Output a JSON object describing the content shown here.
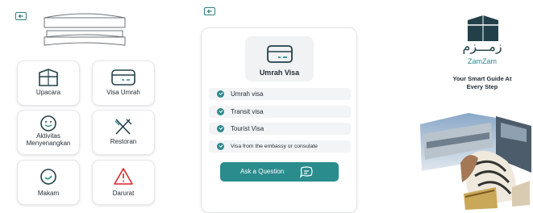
{
  "panel1": {
    "tiles": [
      {
        "label": "Upacara",
        "icon": "kaaba-icon"
      },
      {
        "label": "Visa Umrah",
        "icon": "card-icon"
      },
      {
        "label": "Aktivitas Menyenangkan",
        "icon": "smile-icon"
      },
      {
        "label": "Restoran",
        "icon": "utensils-icon"
      },
      {
        "label": "Makam",
        "icon": "grave-icon"
      },
      {
        "label": "Darurat",
        "icon": "warning-icon"
      }
    ]
  },
  "panel2": {
    "title": "Umrah Visa",
    "items": [
      "Umrah visa",
      "Transit visa",
      "Tourist Visa",
      "Visa from the embassy or consulate"
    ],
    "ask_button": "Ask a Question"
  },
  "panel3": {
    "logo_arabic": "زمـــزم",
    "logo_latin": "ZamZam",
    "tagline": "Your Smart Guide At Every Step"
  },
  "colors": {
    "accent": "#2b8c8e",
    "text": "#1f2a33",
    "tile_border": "#e6e8ea"
  }
}
